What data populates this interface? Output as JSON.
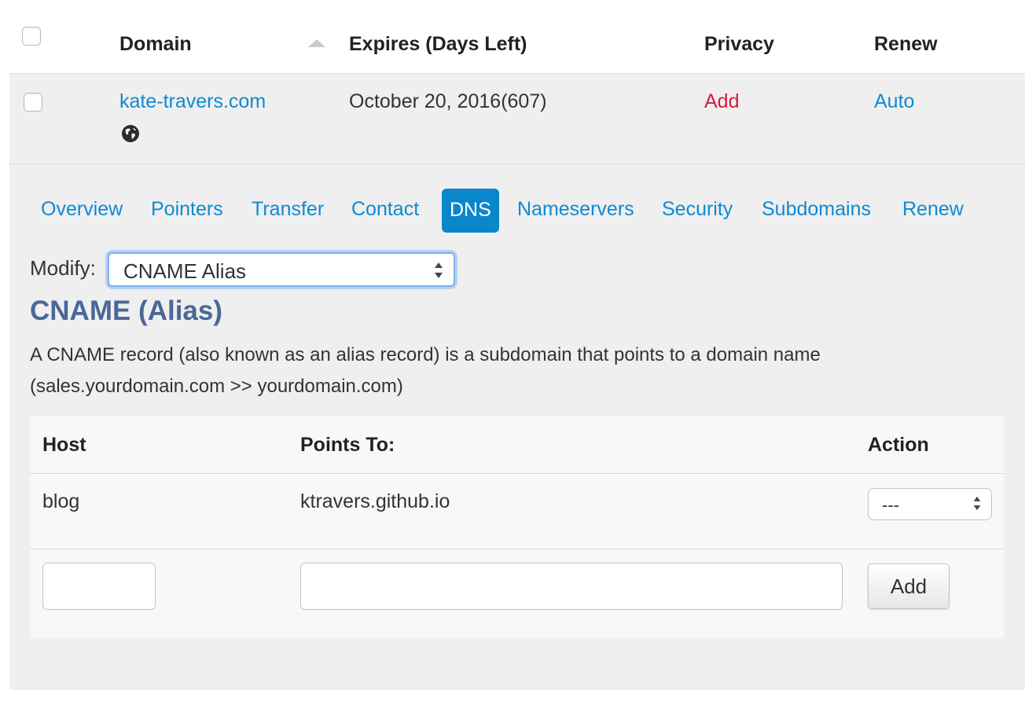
{
  "table_header": {
    "domain": "Domain",
    "expires": "Expires (Days Left)",
    "privacy": "Privacy",
    "renew": "Renew"
  },
  "domain_row": {
    "name": "kate-travers.com",
    "expires": "October 20, 2016(607)",
    "privacy": "Add",
    "renew": "Auto"
  },
  "tabs": [
    {
      "label": "Overview",
      "active": false
    },
    {
      "label": "Pointers",
      "active": false
    },
    {
      "label": "Transfer",
      "active": false
    },
    {
      "label": "Contact",
      "active": false
    },
    {
      "label": "DNS",
      "active": true
    },
    {
      "label": "Nameservers",
      "active": false
    },
    {
      "label": "Security",
      "active": false
    },
    {
      "label": "Subdomains",
      "active": false
    },
    {
      "label": "Renew",
      "active": false
    }
  ],
  "modify": {
    "label": "Modify:",
    "selected": "CNAME Alias"
  },
  "section": {
    "title": "CNAME (Alias)",
    "description": "A CNAME record (also known as an alias record) is a subdomain that points to a domain name (sales.yourdomain.com >> yourdomain.com)"
  },
  "records": {
    "columns": [
      "Host",
      "Points To:",
      "Action"
    ],
    "rows": [
      {
        "host": "blog",
        "points_to": "ktravers.github.io",
        "action": "---"
      }
    ],
    "new_record": {
      "host_value": "",
      "points_to_value": "",
      "add_label": "Add"
    }
  },
  "colors": {
    "link": "#0e8ad4",
    "active_tab": "#0a86cd",
    "privacy_add": "#d7193d",
    "section_title": "#4a6898",
    "panel_bg": "#efefef"
  },
  "icons": [
    "globe-icon",
    "sort-ascending-icon",
    "select-updown-icon"
  ]
}
